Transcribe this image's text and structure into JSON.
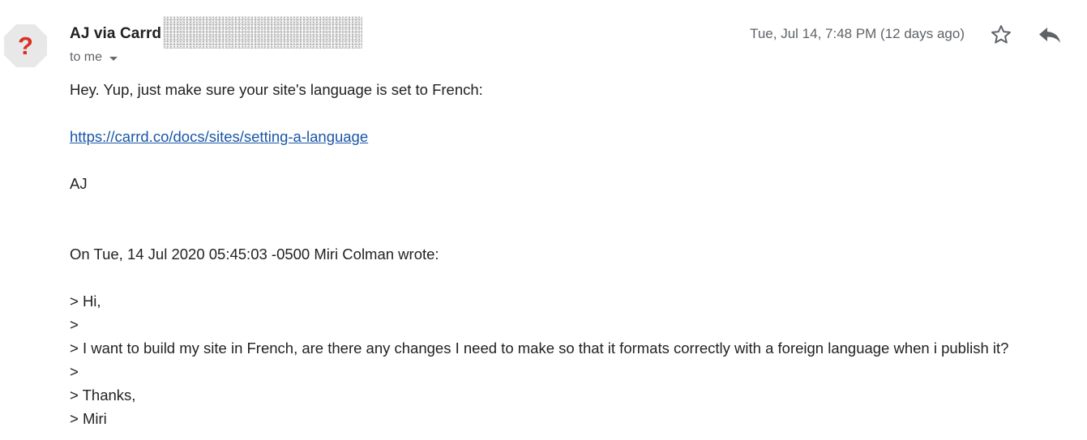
{
  "header": {
    "avatar_glyph": "?",
    "sender_name": "AJ via Carrd",
    "recipient_label": "to me",
    "date": "Tue, Jul 14, 7:48 PM (12 days ago)",
    "star_icon": "star-outline-icon",
    "reply_icon": "reply-icon"
  },
  "message": {
    "greeting": "Hey. Yup, just make sure your site's language is set to French:",
    "link_text": "https://carrd.co/docs/sites/setting-a-language",
    "signature": "AJ",
    "quote_header": "On Tue, 14 Jul 2020 05:45:03 -0500 Miri Colman wrote:",
    "quoted_lines": [
      "> Hi,",
      ">",
      "> I want to build my site in French, are there any changes I need to make so that it formats correctly with a foreign language when i publish it?",
      ">",
      "> Thanks,",
      "> Miri"
    ]
  },
  "colors": {
    "link": "#1a56a8",
    "avatar_bg": "#e8e8e8",
    "avatar_glyph": "#d93025",
    "meta_text": "#5f6368"
  }
}
